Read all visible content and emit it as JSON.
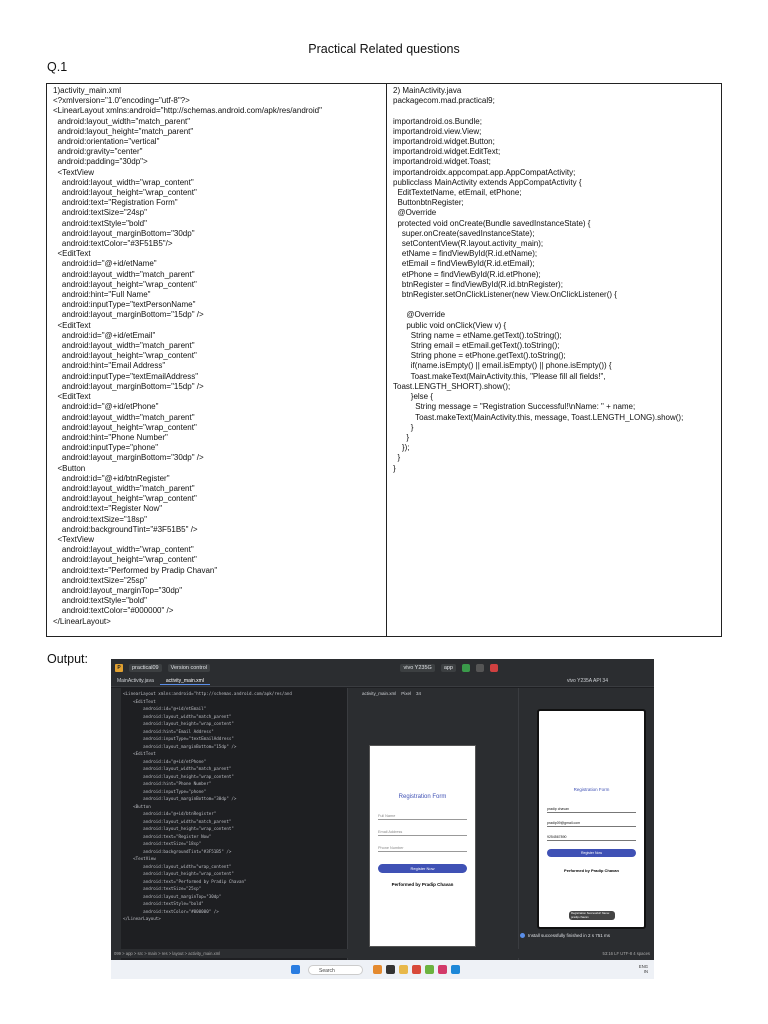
{
  "page": {
    "title": "Practical Related questions",
    "question": "Q.1",
    "output_label": "Output:"
  },
  "left_code": [
    "1)activity_main.xml",
    "<?xmlversion=\"1.0\"encoding=\"utf-8\"?>",
    "<LinearLayout xmlns:android=\"http://schemas.android.com/apk/res/android\"",
    "  android:layout_width=\"match_parent\"",
    "  android:layout_height=\"match_parent\"",
    "  android:orientation=\"vertical\"",
    "  android:gravity=\"center\"",
    "  android:padding=\"30dp\">",
    "  <TextView",
    "    android:layout_width=\"wrap_content\"",
    "    android:layout_height=\"wrap_content\"",
    "    android:text=\"Registration Form\"",
    "    android:textSize=\"24sp\"",
    "    android:textStyle=\"bold\"",
    "    android:layout_marginBottom=\"30dp\"",
    "    android:textColor=\"#3F51B5\"/>",
    "  <EditText",
    "    android:id=\"@+id/etName\"",
    "    android:layout_width=\"match_parent\"",
    "    android:layout_height=\"wrap_content\"",
    "    android:hint=\"Full Name\"",
    "    android:inputType=\"textPersonName\"",
    "    android:layout_marginBottom=\"15dp\" />",
    "  <EditText",
    "    android:id=\"@+id/etEmail\"",
    "    android:layout_width=\"match_parent\"",
    "    android:layout_height=\"wrap_content\"",
    "    android:hint=\"Email Address\"",
    "    android:inputType=\"textEmailAddress\"",
    "    android:layout_marginBottom=\"15dp\" />",
    "  <EditText",
    "    android:id=\"@+id/etPhone\"",
    "    android:layout_width=\"match_parent\"",
    "    android:layout_height=\"wrap_content\"",
    "    android:hint=\"Phone Number\"",
    "    android:inputType=\"phone\"",
    "    android:layout_marginBottom=\"30dp\" />",
    "  <Button",
    "    android:id=\"@+id/btnRegister\"",
    "    android:layout_width=\"match_parent\"",
    "    android:layout_height=\"wrap_content\"",
    "    android:text=\"Register Now\"",
    "    android:textSize=\"18sp\"",
    "    android:backgroundTint=\"#3F51B5\" />",
    "  <TextView",
    "    android:layout_width=\"wrap_content\"",
    "    android:layout_height=\"wrap_content\"",
    "    android:text=\"Performed by Pradip Chavan\"",
    "    android:textSize=\"25sp\"",
    "    android:layout_marginTop=\"30dp\"",
    "    android:textStyle=\"bold\"",
    "    android:textColor=\"#000000\" />",
    "</LinearLayout>"
  ],
  "right_code": [
    "2) MainActivity.java",
    "packagecom.mad.practical9;",
    "",
    "importandroid.os.Bundle;",
    "importandroid.view.View;",
    "importandroid.widget.Button;",
    "importandroid.widget.EditText;",
    "importandroid.widget.Toast;",
    "importandroidx.appcompat.app.AppCompatActivity;",
    "publicclass MainActivity extends AppCompatActivity {",
    "  EditTextetName, etEmail, etPhone;",
    "  ButtonbtnRegister;",
    "  @Override",
    "  protected void onCreate(Bundle savedInstanceState) {",
    "    super.onCreate(savedInstanceState);",
    "    setContentView(R.layout.activity_main);",
    "    etName = findViewById(R.id.etName);",
    "    etEmail = findViewById(R.id.etEmail);",
    "    etPhone = findViewById(R.id.etPhone);",
    "    btnRegister = findViewById(R.id.btnRegister);",
    "    btnRegister.setOnClickListener(new View.OnClickListener() {",
    "",
    "      @Override",
    "      public void onClick(View v) {",
    "        String name = etName.getText().toString();",
    "        String email = etEmail.getText().toString();",
    "        String phone = etPhone.getText().toString();",
    "        if(name.isEmpty() || email.isEmpty() || phone.isEmpty()) {",
    "        Toast.makeText(MainActivity.this, \"Please fill all fields!\",",
    "Toast.LENGTH_SHORT).show();",
    "        }else {",
    "          String message = \"Registration Successful!\\nName: \" + name;",
    "          Toast.makeText(MainActivity.this, message, Toast.LENGTH_LONG).show();",
    "        }",
    "      }",
    "    });",
    "  }",
    "}"
  ],
  "ide": {
    "project": "practical09",
    "project_badge": "P",
    "version_control": "Version control",
    "device": "vivo Y235G",
    "run_config": "app",
    "tabs": [
      "MainActivity.java",
      "activity_main.xml"
    ],
    "emulator_tab": "vivo Y235A API 34",
    "design_file": "activity_main.xml",
    "design_theme": "Pixel",
    "design_zoom": "34",
    "code_lines": [
      "<LinearLayout xmlns:android=\"http://schemas.android.com/apk/res/and",
      "    <EditText",
      "        android:id=\"@+id/etEmail\"",
      "        android:layout_width=\"match_parent\"",
      "        android:layout_height=\"wrap_content\"",
      "        android:hint=\"Email Address\"",
      "        android:inputType=\"textEmailAddress\"",
      "        android:layout_marginBottom=\"15dp\" />",
      "    <EditText",
      "        android:id=\"@+id/etPhone\"",
      "        android:layout_width=\"match_parent\"",
      "        android:layout_height=\"wrap_content\"",
      "        android:hint=\"Phone Number\"",
      "        android:inputType=\"phone\"",
      "        android:layout_marginBottom=\"30dp\" />",
      "    <Button",
      "        android:id=\"@+id/btnRegister\"",
      "        android:layout_width=\"match_parent\"",
      "        android:layout_height=\"wrap_content\"",
      "        android:text=\"Register Now\"",
      "        android:textSize=\"18sp\"",
      "        android:backgroundTint=\"#3F51B5\" />",
      "    <TextView",
      "        android:layout_width=\"wrap_content\"",
      "        android:layout_height=\"wrap_content\"",
      "        android:text=\"Performed by Pradip Chavan\"",
      "        android:textSize=\"25sp\"",
      "        android:layout_marginTop=\"30dp\"",
      "        android:textStyle=\"bold\"",
      "        android:textColor=\"#000000\" />",
      "</LinearLayout>"
    ],
    "preview": {
      "title": "Registration Form",
      "hint_name": "Full Name",
      "hint_email": "Email Address",
      "hint_phone": "Phone Number",
      "button": "Register Now",
      "performed_by": "Performed by Pradip Chavan"
    },
    "emulator": {
      "title": "Registration Form",
      "name_value": "pradip chavan",
      "email_value": "pradip09@gmail.com",
      "phone_value": "9254567890",
      "button": "Register Now",
      "performed_by": "Performed by Pradip Chavan",
      "toast": "Registration Successful! Name: pradip chavan"
    },
    "install_message": "Install successfully finished in 2 s 751 ms",
    "breadcrumb": "099 > app > src > main > res > layout > activity_main.xml",
    "cursor_pos": "53:16   LF   UTF-8   4 spaces",
    "taskbar_search": "Search",
    "tray_lang": "ENG\nIN",
    "accent_color": "#3F51B5"
  }
}
